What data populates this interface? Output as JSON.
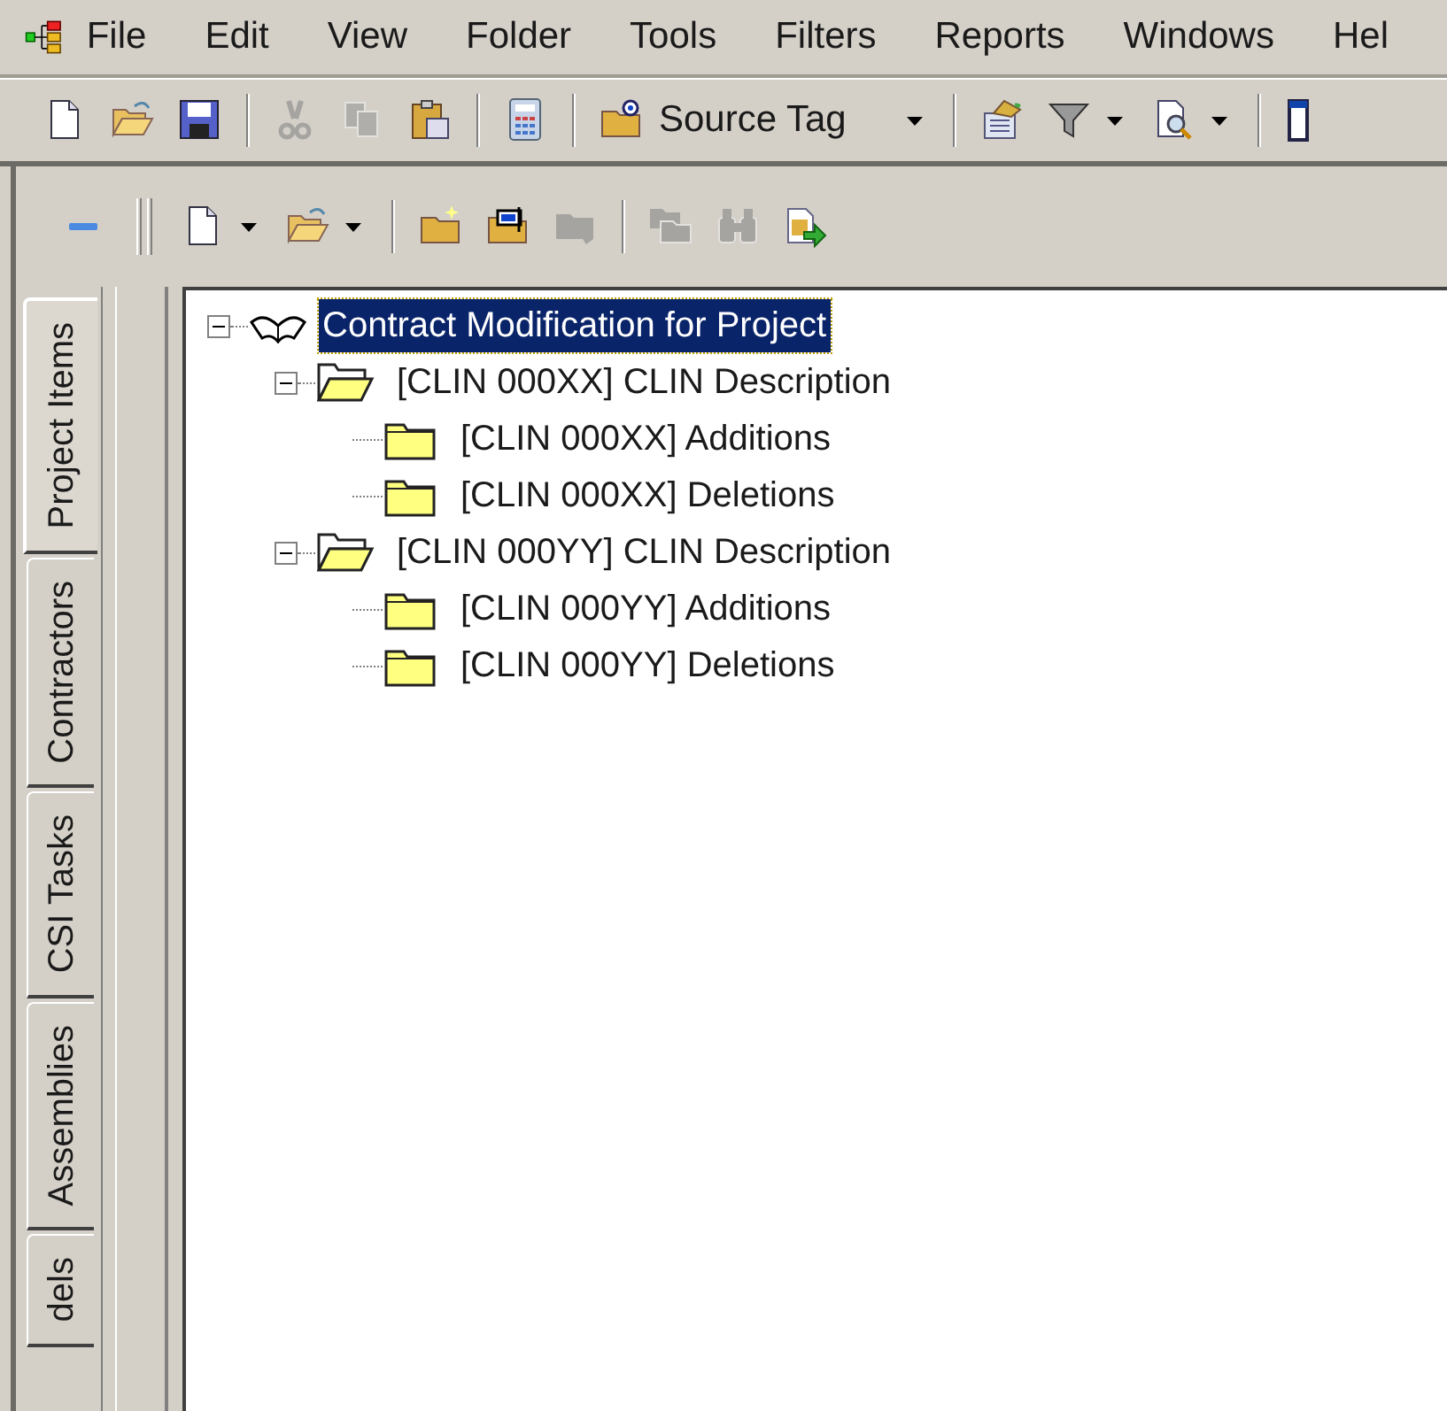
{
  "menu_bar": {
    "items": [
      "File",
      "Edit",
      "View",
      "Folder",
      "Tools",
      "Filters",
      "Reports",
      "Windows",
      "Hel"
    ]
  },
  "main_toolbar": [
    {
      "kind": "new-document",
      "disabled": false
    },
    {
      "kind": "open-folder",
      "disabled": false
    },
    {
      "kind": "save",
      "disabled": false
    },
    {
      "kind": "separator"
    },
    {
      "kind": "cut",
      "disabled": true
    },
    {
      "kind": "copy",
      "disabled": true
    },
    {
      "kind": "paste",
      "disabled": false
    },
    {
      "kind": "separator"
    },
    {
      "kind": "calculator",
      "disabled": false
    },
    {
      "kind": "separator"
    },
    {
      "kind": "source-tag",
      "label": "Source Tag",
      "disabled": false,
      "dropdown": true
    },
    {
      "kind": "separator"
    },
    {
      "kind": "properties",
      "disabled": false
    },
    {
      "kind": "filter",
      "disabled": false,
      "dropdown": true
    },
    {
      "kind": "preview",
      "disabled": false,
      "dropdown": true
    },
    {
      "kind": "separator"
    },
    {
      "kind": "window",
      "disabled": false
    }
  ],
  "tree_toolbar": [
    {
      "kind": "collapse",
      "disabled": false
    },
    {
      "kind": "grip"
    },
    {
      "kind": "new-document",
      "disabled": false,
      "dropdown": true
    },
    {
      "kind": "open-folder",
      "disabled": false,
      "dropdown": true
    },
    {
      "kind": "separator"
    },
    {
      "kind": "new-folder",
      "disabled": false
    },
    {
      "kind": "rename-folder",
      "disabled": false
    },
    {
      "kind": "folder",
      "disabled": true
    },
    {
      "kind": "separator"
    },
    {
      "kind": "move",
      "disabled": true
    },
    {
      "kind": "find",
      "disabled": true
    },
    {
      "kind": "refresh",
      "disabled": false
    }
  ],
  "side_tabs": [
    {
      "label": "Project Items",
      "selected": true
    },
    {
      "label": "Contractors",
      "selected": false
    },
    {
      "label": "CSI Tasks",
      "selected": false
    },
    {
      "label": "Assemblies",
      "selected": false
    },
    {
      "label": "dels",
      "selected": false
    }
  ],
  "tree": {
    "root": {
      "label": "Contract Modification for Project",
      "kind": "book",
      "selected": true,
      "expanded": true,
      "children": [
        {
          "label": "[CLIN 000XX] CLIN Description",
          "kind": "folder",
          "selected": false,
          "expanded": true,
          "children": [
            {
              "label": "[CLIN 000XX] Additions",
              "kind": "folder",
              "selected": false
            },
            {
              "label": "[CLIN 000XX] Deletions",
              "kind": "folder",
              "selected": false
            }
          ]
        },
        {
          "label": "[CLIN 000YY] CLIN Description",
          "kind": "folder",
          "selected": false,
          "expanded": true,
          "children": [
            {
              "label": "[CLIN 000YY] Additions",
              "kind": "folder",
              "selected": false
            },
            {
              "label": "[CLIN 000YY] Deletions",
              "kind": "folder",
              "selected": false
            }
          ]
        }
      ]
    }
  }
}
